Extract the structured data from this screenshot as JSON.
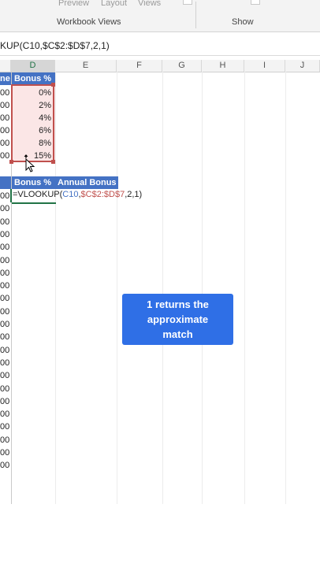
{
  "ribbon": {
    "preview_label": "Preview",
    "layout_label": "Layout",
    "views_label": "Views",
    "workbook_views_label": "Workbook Views",
    "show_label": "Show"
  },
  "formula_bar": {
    "text": "KUP(C10,$C$2:$D$7,2,1)"
  },
  "columns": [
    "D",
    "E",
    "F",
    "G",
    "H",
    "I",
    "J"
  ],
  "bonus_table": {
    "header_left": "ne",
    "header": "Bonus %",
    "left_values": [
      "00",
      "00",
      "00",
      "00",
      "00",
      "00"
    ],
    "pct_values": [
      "0%",
      "2%",
      "4%",
      "6%",
      "8%",
      "15%"
    ]
  },
  "employee_table": {
    "header_left": "",
    "col1_header": "Bonus %",
    "col2_header": "Annual Bonus",
    "left_values": [
      "00",
      "00",
      "00",
      "00",
      "00",
      "00",
      "00",
      "00",
      "00",
      "00",
      "00",
      "00",
      "00",
      "00",
      "00",
      "00",
      "00",
      "00",
      "00",
      "00",
      "00",
      "00"
    ]
  },
  "formula_cell": {
    "prefix": "=VLOOKUP(",
    "ref1": "C10",
    "comma1": ",",
    "ref2": "$C$2:$D$7",
    "suffix": ",2,1)"
  },
  "callout": {
    "line1": "1 returns the",
    "line2": "approximate",
    "line3": "match"
  },
  "colors": {
    "header_blue": "#4472c4",
    "selection_red": "#c0504d",
    "callout_blue": "#2f6fe6",
    "excel_green": "#217346"
  }
}
